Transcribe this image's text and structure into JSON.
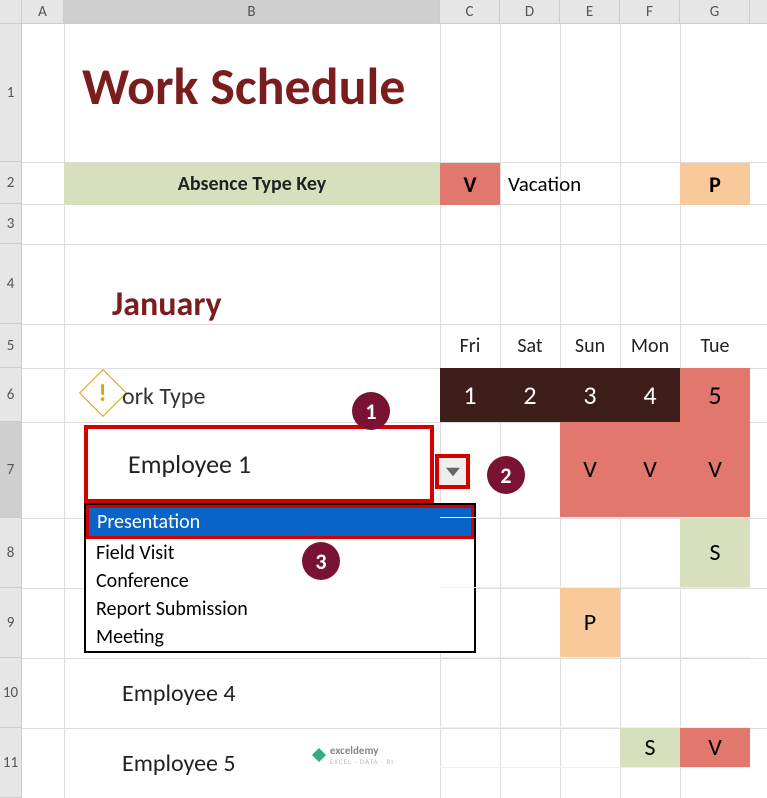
{
  "columns": [
    "A",
    "B",
    "C",
    "D",
    "E",
    "F",
    "G"
  ],
  "rows": [
    "1",
    "2",
    "3",
    "4",
    "5",
    "6",
    "7",
    "8",
    "9",
    "10",
    "11"
  ],
  "title": "Work Schedule",
  "key": {
    "label": "Absence Type Key",
    "v": "V",
    "vacation": "Vacation",
    "p": "P"
  },
  "month": "January",
  "days": {
    "labels": [
      "Fri",
      "Sat",
      "Sun",
      "Mon",
      "Tue"
    ],
    "nums": [
      "1",
      "2",
      "3",
      "4",
      "5"
    ]
  },
  "worktype_partial": "ork Type",
  "error_mark": "!",
  "selected_cell": "Employee 1",
  "dropdown": {
    "selected": "Presentation",
    "items": [
      "Field Visit",
      "Conference",
      "Report Submission",
      "Meeting"
    ]
  },
  "badges": {
    "b1": "1",
    "b2": "2",
    "b3": "3"
  },
  "employees_lower": {
    "e4": "Employee 4",
    "e5": "Employee 5"
  },
  "calendar": {
    "row7": [
      "",
      "",
      "V",
      "V",
      "V"
    ],
    "row8": [
      "",
      "",
      "",
      "",
      "S"
    ],
    "row9": [
      "",
      "",
      "P",
      "",
      ""
    ],
    "row10": [
      "",
      "",
      "",
      "",
      ""
    ],
    "row11": [
      "",
      "",
      "",
      "S",
      "V"
    ]
  },
  "watermark": {
    "brand": "exceldemy",
    "sub": "EXCEL · DATA · BI"
  }
}
